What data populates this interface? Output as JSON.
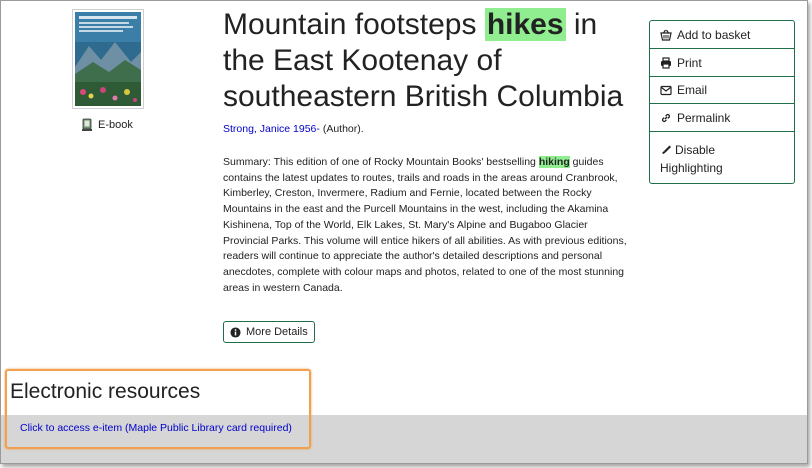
{
  "record": {
    "title_before": "Mountain footsteps ",
    "title_highlight": "hikes",
    "title_after": " in the East Kootenay of southeastern British Columbia",
    "format_label": "E-book",
    "author_link": "Strong, Janice 1956-",
    "author_role": " (Author).",
    "summary_before": "Summary: This edition of one of Rocky Mountain Books' bestselling ",
    "summary_highlight": "hiking",
    "summary_after": " guides contains the latest updates to routes, trails and roads in the areas around Cranbrook, Kimberley, Creston, Invermere, Radium and Fernie, located between the Rocky Mountains in the east and the Purcell Mountains in the west, including the Akamina Kishinena, Top of the World, Elk Lakes, St. Mary's Alpine and Bugaboo Glacier Provincial Parks. This volume will entice hikers of all abilities. As with previous editions, readers will continue to appreciate the author's detailed descriptions and personal anecdotes, complete with colour maps and photos, related to one of the most stunning areas in western Canada.",
    "more_details_label": "More Details"
  },
  "actions": {
    "add_to_basket": "Add to basket",
    "print": "Print",
    "email": "Email",
    "permalink": "Permalink",
    "disable_highlighting_1": "Disable",
    "disable_highlighting_2": "Highlighting"
  },
  "electronic_resources": {
    "heading": "Electronic resources",
    "link_text": "Click to access e-item (Maple Public Library card required)"
  },
  "icons": {
    "basket": "basket-icon",
    "print": "print-icon",
    "email": "envelope-icon",
    "permalink": "link-icon",
    "highlight": "marker-icon",
    "info": "info-circle-icon",
    "ebook": "ebook-icon"
  },
  "colors": {
    "highlight": "#90ee90",
    "link": "#0000cc",
    "button_border": "#1f6f4a",
    "annotation_box": "#f0a050",
    "resource_bar": "#d6d6d6"
  }
}
